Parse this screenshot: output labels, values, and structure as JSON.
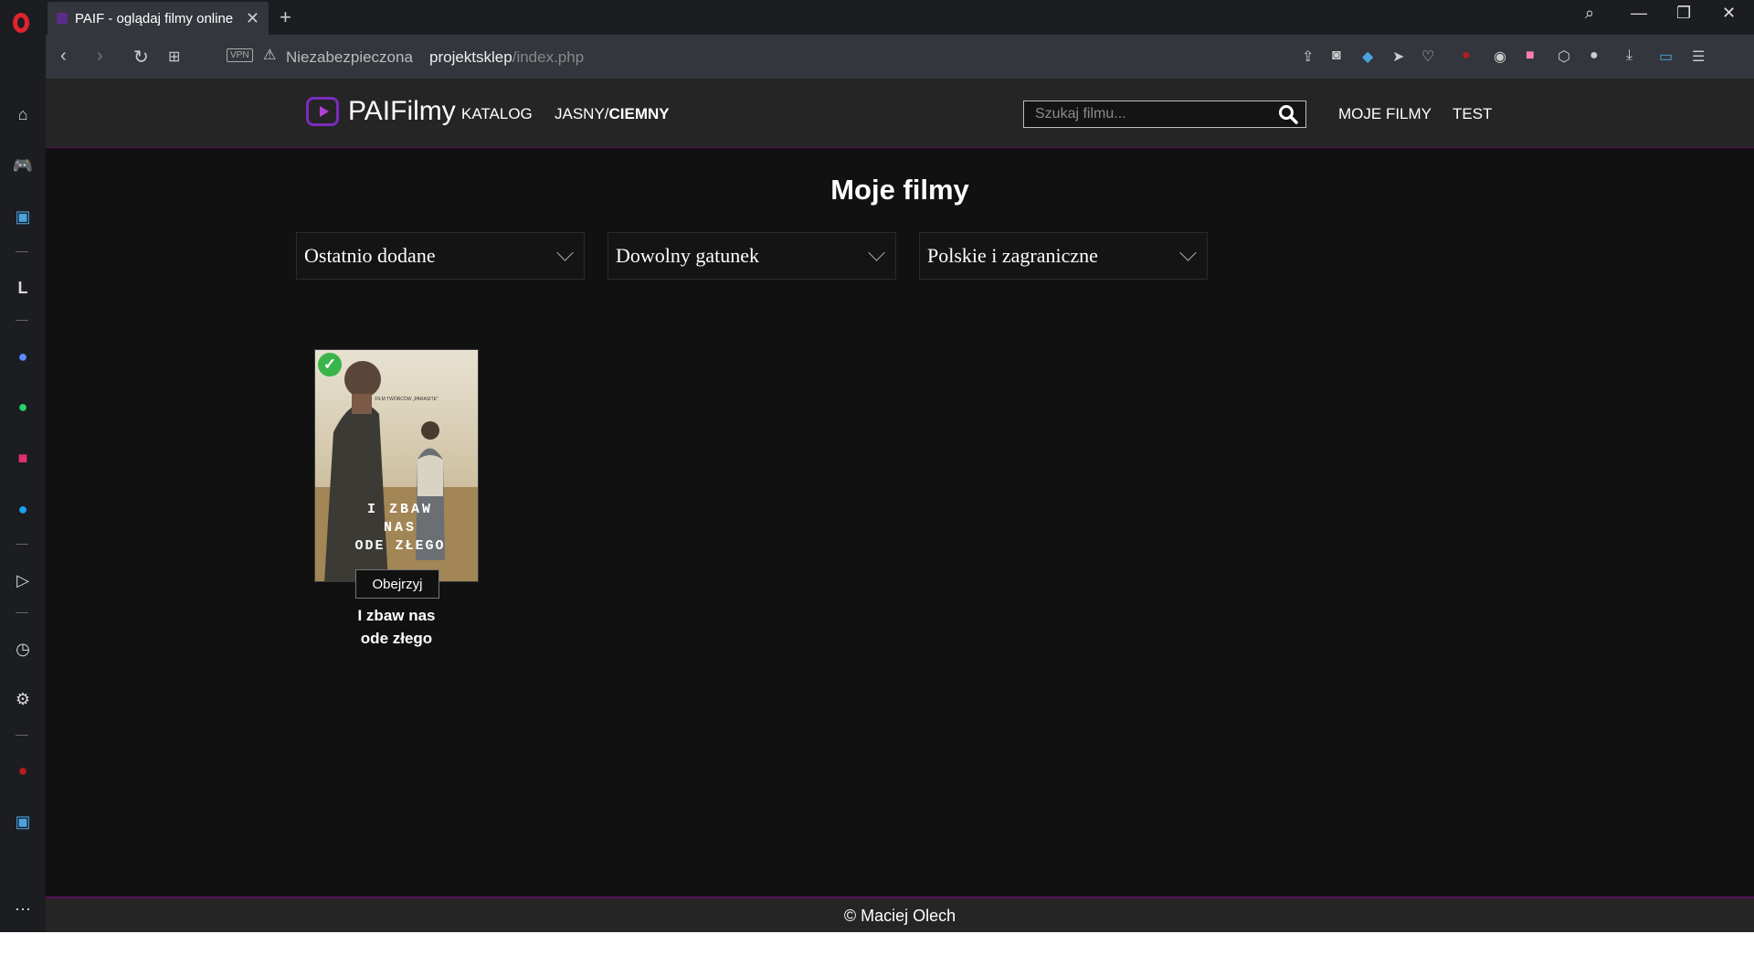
{
  "browser": {
    "tab_title": "PAIF - oglądaj filmy online",
    "tab_close": "✕",
    "new_tab": "+",
    "vpn_label": "VPN",
    "security_label": "Niezabezpieczona",
    "url_host": "projektsklep",
    "url_path": "/index.php",
    "accent": "#e0242e"
  },
  "site": {
    "logo_text": "PAIFilmy",
    "nav": {
      "catalog": "KATALOG",
      "theme_light": "JASNY/",
      "theme_dark": "CIEMNY",
      "my_films": "MOJE FILMY",
      "test": "TEST"
    },
    "search": {
      "placeholder": "Szukaj filmu..."
    },
    "brand_color": "#57115e"
  },
  "main": {
    "title": "Moje filmy",
    "filters": {
      "sort": "Ostatnio dodane",
      "genre": "Dowolny gatunek",
      "origin": "Polskie i zagraniczne"
    },
    "movies": [
      {
        "title": "I zbaw nas ode złego",
        "poster_lines": [
          "I ZBAW",
          "NAS",
          "ODE ZŁEGO"
        ],
        "poster_tagline": "FILM TWÓRCÓW „PARASITE”",
        "watched": true,
        "button": "Obejrzyj"
      }
    ]
  },
  "footer": {
    "text": "© Maciej Olech"
  }
}
